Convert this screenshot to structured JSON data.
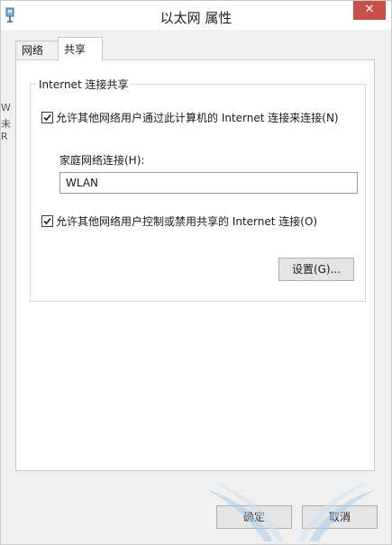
{
  "window": {
    "title": "以太网 属性",
    "close_label": "✕"
  },
  "tabs": [
    {
      "label": "网络",
      "active": false
    },
    {
      "label": "共享",
      "active": true
    }
  ],
  "sharing": {
    "group_title": "Internet 连接共享",
    "allow_connect": {
      "label": "允许其他网络用户通过此计算机的 Internet 连接来连接(N)",
      "checked": true
    },
    "home_network": {
      "label": "家庭网络连接(H):",
      "value": "WLAN"
    },
    "allow_control": {
      "label": "允许其他网络用户控制或禁用共享的 Internet 连接(O)",
      "checked": true
    },
    "settings_button": "设置(G)..."
  },
  "footer": {
    "ok_button": "确定",
    "cancel_button": "取消"
  },
  "left_fragments": [
    "W",
    "未",
    "R"
  ],
  "colors": {
    "close": "#c7504a",
    "window_bg": "#f0f0f0",
    "panel_bg": "#ffffff"
  }
}
